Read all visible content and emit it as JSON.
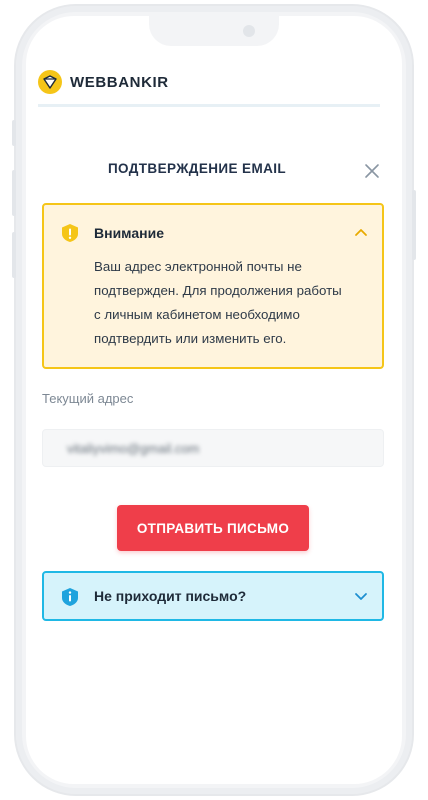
{
  "brand": {
    "name": "WEBBANKIR",
    "icon": "webbankir-logo-icon",
    "accent": "#f5c518"
  },
  "modal": {
    "title": "ПОДТВЕРЖДЕНИЕ EMAIL",
    "close_icon": "close-icon"
  },
  "warning": {
    "title": "Внимание",
    "icon": "warning-shield-icon",
    "body_lines": [
      "Ваш адрес электронной почты не",
      "подтвержден. Для продолжения работы",
      "с личным кабинетом необходимо",
      "подтвердить или изменить его."
    ],
    "expanded": true,
    "color": "#f5c518"
  },
  "email_field": {
    "label": "Текущий адрес",
    "value": "vitaliyvimo@gmail.com"
  },
  "send_button": {
    "label": "ОТПРАВИТЬ ПИСЬМО",
    "color": "#ef3e4a"
  },
  "help": {
    "title": "Не приходит письмо?",
    "icon": "info-shield-icon",
    "expanded": false,
    "color": "#1fb8e5"
  }
}
